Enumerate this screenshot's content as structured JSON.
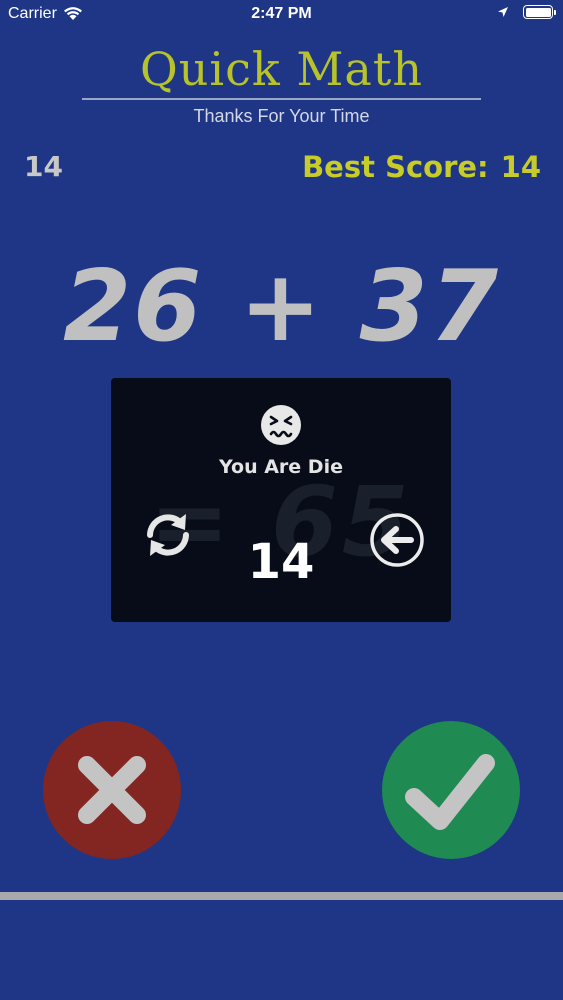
{
  "status_bar": {
    "carrier": "Carrier",
    "time": "2:47 PM"
  },
  "header": {
    "title": "Quick Math",
    "subtitle": "Thanks For Your Time"
  },
  "score": {
    "current": "14",
    "best_label": "Best Score:",
    "best_value": "14"
  },
  "problem": {
    "expression": "26 + 37"
  },
  "dialog": {
    "ghost_answer": "= 65",
    "message": "You Are Die",
    "final_score": "14",
    "icons": {
      "face": "sick-face-icon",
      "replay": "replay-icon",
      "back": "back-arrow-icon"
    }
  },
  "answer_buttons": {
    "wrong_icon": "x-icon",
    "right_icon": "checkmark-icon"
  },
  "colors": {
    "background": "#1e3685",
    "title": "#b8c22b",
    "best_score": "#c8cc28",
    "wrong_button": "#832621",
    "right_button": "#1f8a52",
    "dialog": "#080c18"
  }
}
